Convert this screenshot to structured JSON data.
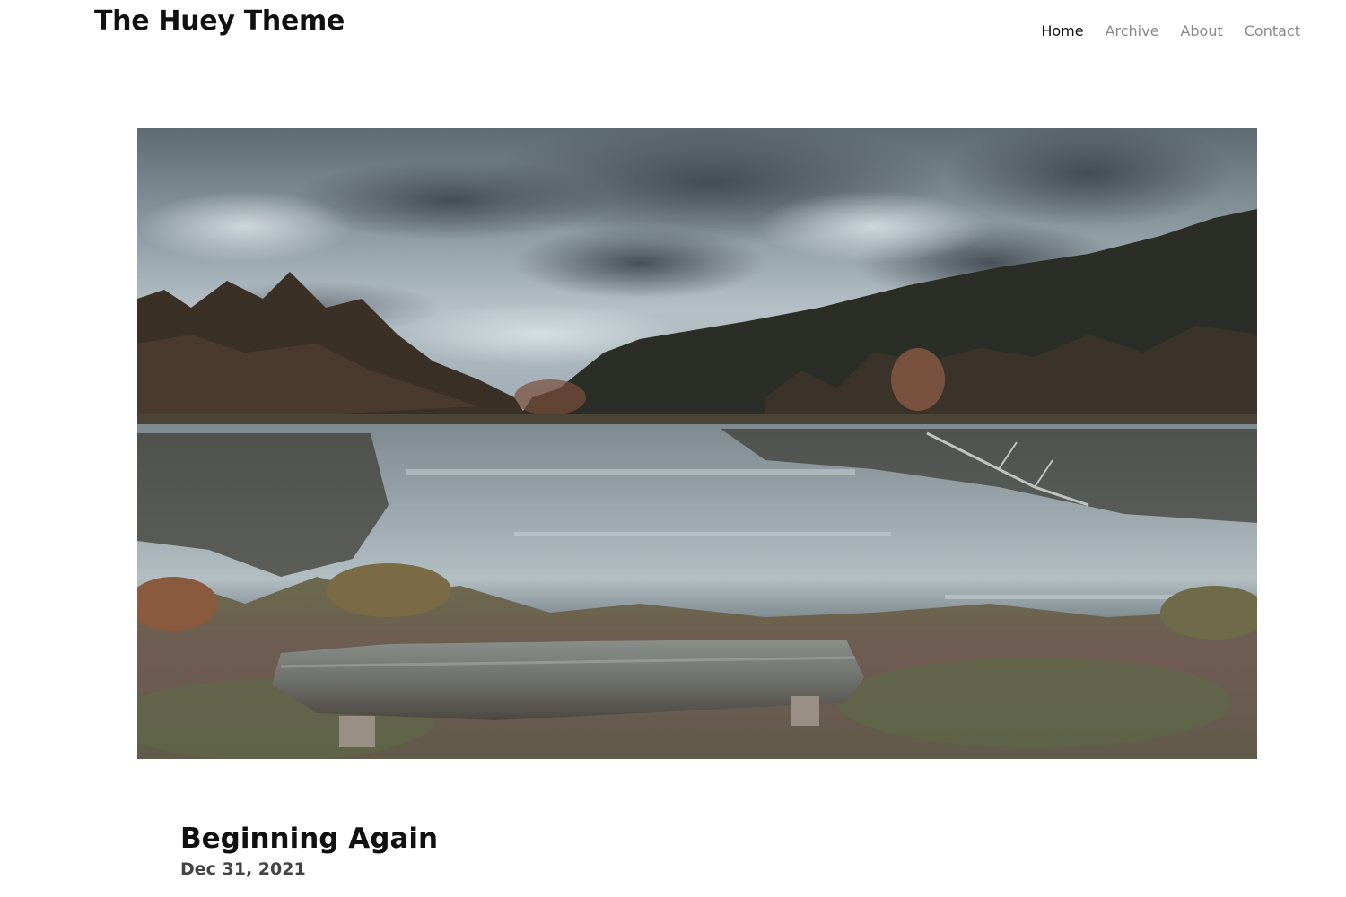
{
  "site": {
    "title": "The Huey Theme"
  },
  "nav": {
    "items": [
      {
        "label": "Home",
        "active": true
      },
      {
        "label": "Archive",
        "active": false
      },
      {
        "label": "About",
        "active": false
      },
      {
        "label": "Contact",
        "active": false
      }
    ]
  },
  "post": {
    "title": "Beginning Again",
    "date": "Dec 31, 2021",
    "featured_image": {
      "icon": "lake-landscape-photo"
    }
  },
  "colors": {
    "text_primary": "#111111",
    "text_muted": "#8a8a8a",
    "background": "#ffffff"
  }
}
